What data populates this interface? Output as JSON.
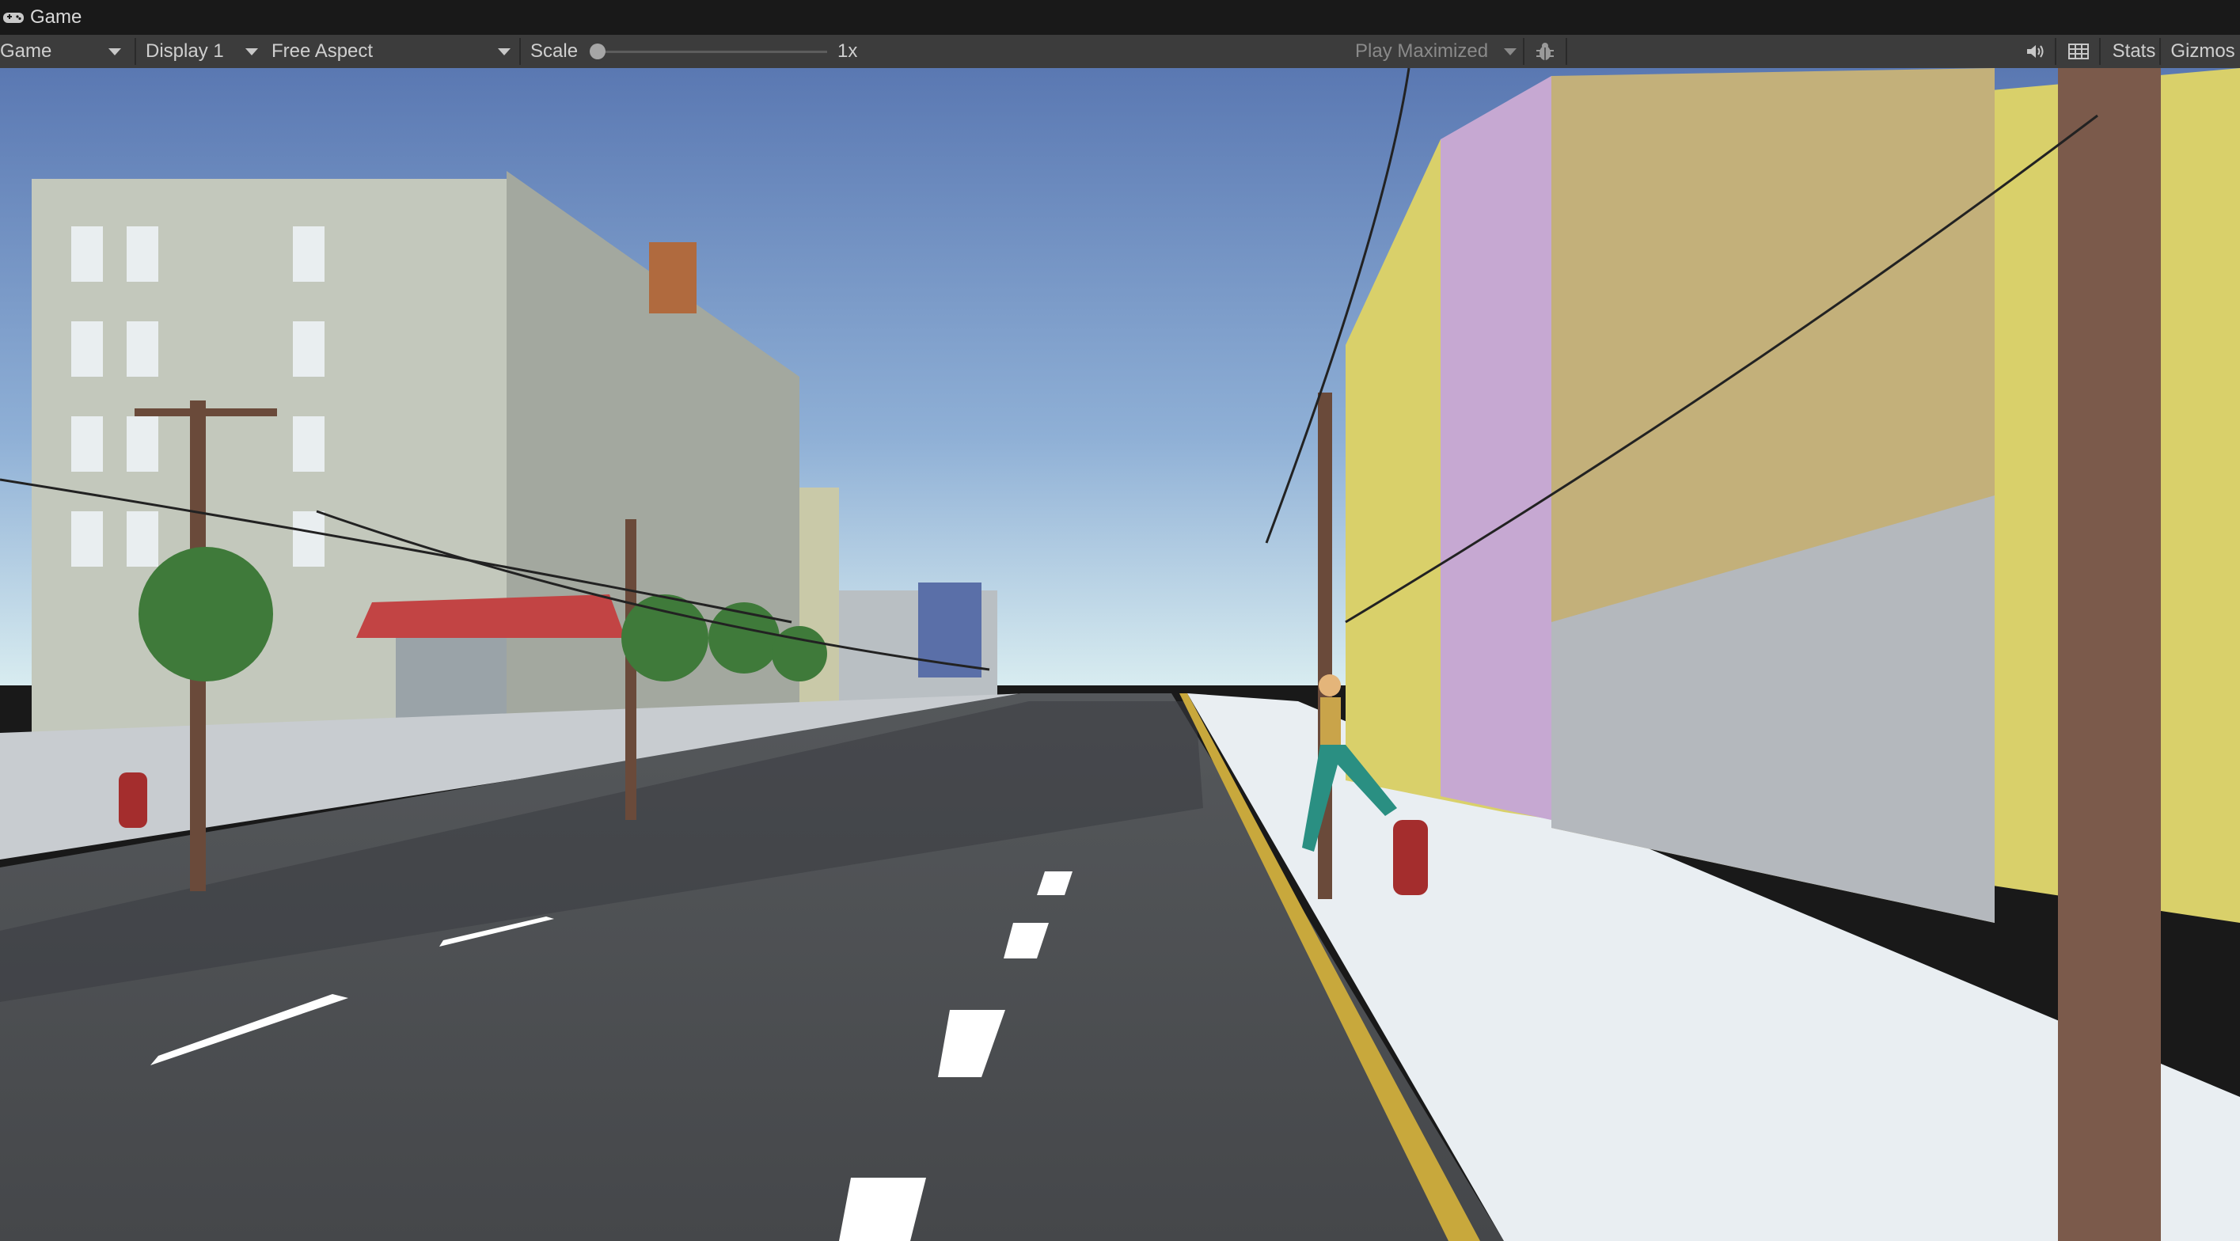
{
  "window": {
    "tab_label": "Game",
    "tab_icon": "gamepad-icon"
  },
  "toolbar": {
    "view_dropdown": "Game",
    "display_dropdown": "Display 1",
    "aspect_dropdown": "Free Aspect",
    "scale_label": "Scale",
    "scale_value": "1x",
    "scale_fraction": 0.0,
    "play_maximized_label": "Play Maximized",
    "bug_icon": "bug-icon",
    "mute_icon": "speaker-icon",
    "grid_icon": "grid-icon",
    "stats_label": "Stats",
    "gizmos_label": "Gizmos"
  },
  "scene": {
    "description_icon": "game-viewport",
    "colors": {
      "sky_top": "#5a7bb4",
      "sky_horizon": "#cfe3ec",
      "road": "#4a4c4f",
      "curb_yellow": "#c8a83c",
      "sidewalk": "#e9eef2"
    }
  }
}
